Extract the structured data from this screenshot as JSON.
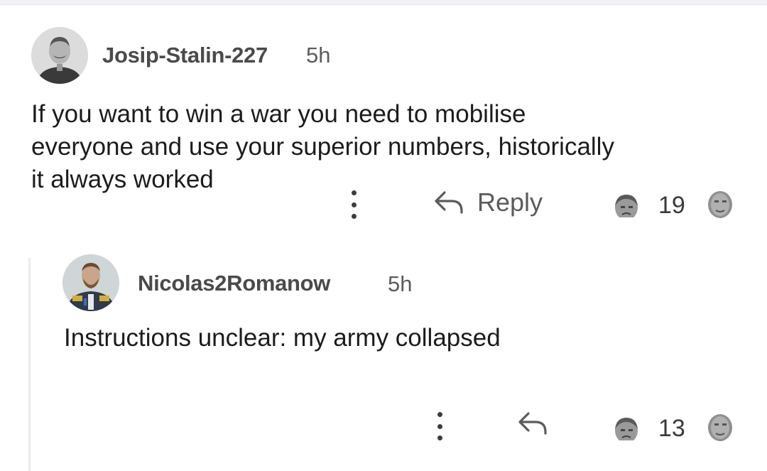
{
  "comments": [
    {
      "username": "Josip-Stalin-227",
      "time": "5h",
      "body": "If you want to win a war you need to mobilise\neveryone and use your superior numbers, historically\nit always worked",
      "reply_label": "Reply",
      "votes": "19",
      "avatar_icon": "portrait-avatar"
    },
    {
      "username": "Nicolas2Romanow",
      "time": "5h",
      "body": "Instructions unclear: my army collapsed",
      "reply_label": "",
      "votes": "13",
      "avatar_icon": "portrait-avatar"
    }
  ],
  "icons": {
    "more": "more-vertical-icon",
    "reply": "reply-arrow-icon",
    "upvote": "face-upvote-icon",
    "downvote": "face-downvote-icon"
  },
  "colors": {
    "text": "#1c1c1c",
    "meta": "#5b5b5b",
    "thread_line": "#ececec"
  }
}
